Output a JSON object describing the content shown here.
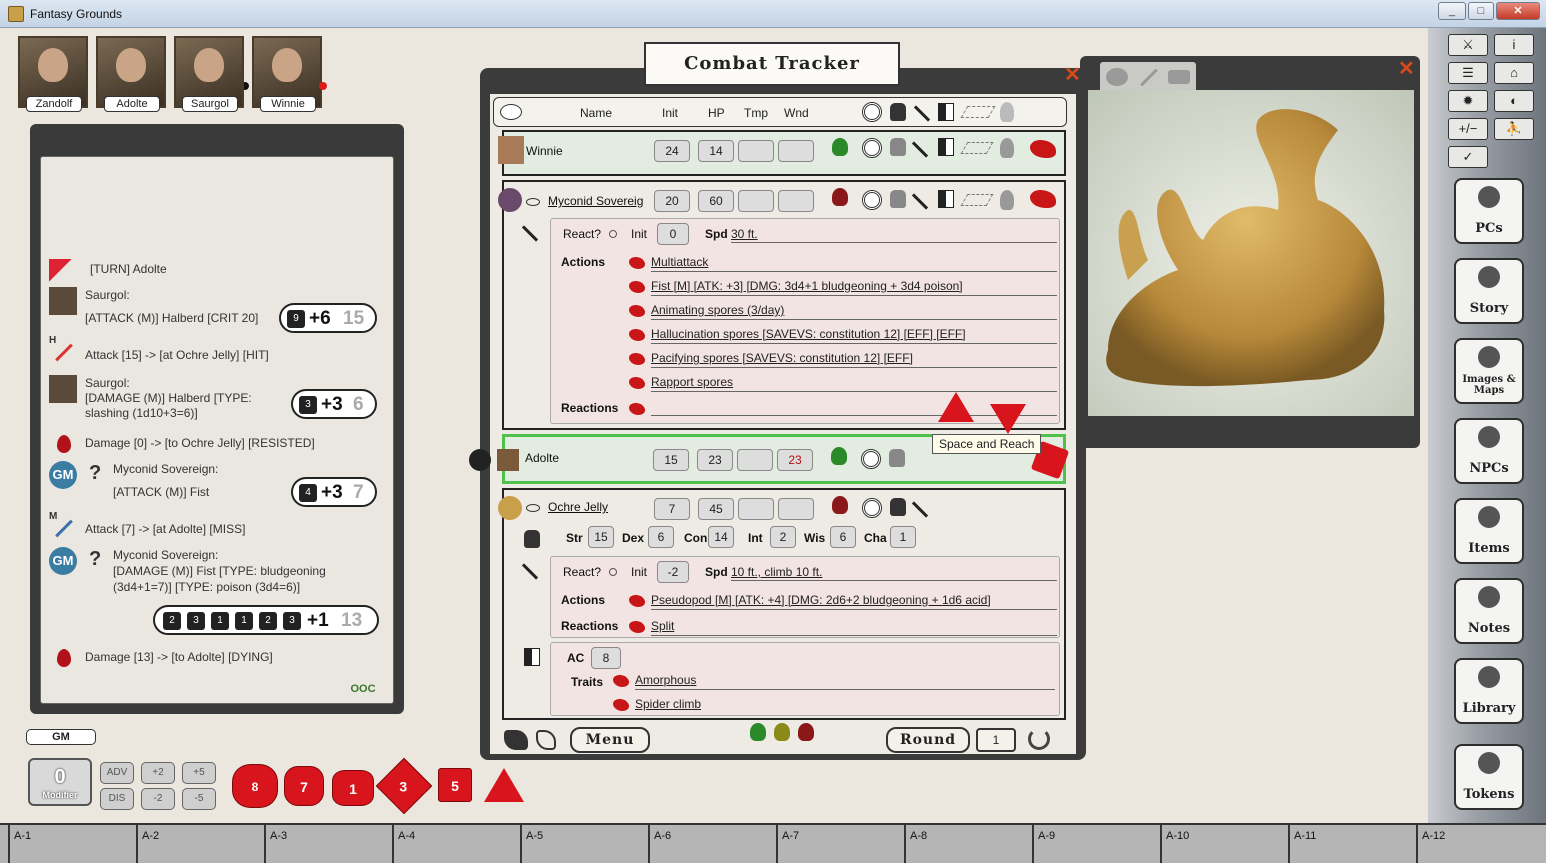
{
  "window": {
    "title": "Fantasy Grounds",
    "minimize": "_",
    "maximize": "□",
    "close": "✕"
  },
  "party": [
    {
      "name": "Zandolf"
    },
    {
      "name": "Adolte"
    },
    {
      "name": "Saurgol"
    },
    {
      "name": "Winnie"
    }
  ],
  "chat": {
    "entries": [
      {
        "text": "[TURN] Adolte"
      },
      {
        "speaker": "Saurgol:",
        "text": "[ATTACK (M)] Halberd [CRIT 20]",
        "roll": {
          "die": "9",
          "mod": "+6",
          "total": "15"
        }
      },
      {
        "text": "Attack [15] -> [at Ochre Jelly] [HIT]",
        "tag": "H"
      },
      {
        "speaker": "Saurgol:",
        "text": "[DAMAGE (M)] Halberd [TYPE:",
        "text2": "slashing (1d10+3=6)]",
        "roll": {
          "die": "3",
          "mod": "+3",
          "total": "6"
        }
      },
      {
        "text": "Damage [0] -> [to Ochre Jelly] [RESISTED]"
      },
      {
        "speaker": "Myconid Sovereign:",
        "text": "[ATTACK (M)] Fist",
        "roll": {
          "die": "4",
          "mod": "+3",
          "total": "7"
        }
      },
      {
        "text": "Attack [7] -> [at Adolte] [MISS]",
        "tag": "M"
      },
      {
        "speaker": "Myconid Sovereign:",
        "text": "[DAMAGE (M)] Fist [TYPE: bludgeoning",
        "text2": "(3d4+1=7)] [TYPE: poison (3d4=6)]",
        "roll": {
          "dice": [
            "2",
            "3",
            "1",
            "1",
            "2",
            "3"
          ],
          "mod": "+1",
          "total": "13"
        }
      },
      {
        "text": "Damage [13] -> [to Adolte] [DYING]"
      }
    ],
    "gm_badge": "GM",
    "ooc": "OOC",
    "question": "?"
  },
  "controls": {
    "gm_label": "GM",
    "modifier_value": "0",
    "modifier_label": "Modifier",
    "buttons": [
      "ADV",
      "+2",
      "+5",
      "DIS",
      "-2",
      "-5"
    ],
    "dice": [
      "8",
      "7",
      "1",
      "3",
      "5"
    ]
  },
  "combat_tracker": {
    "title": "Combat Tracker",
    "headers": {
      "name": "Name",
      "init": "Init",
      "hp": "HP",
      "tmp": "Tmp",
      "wnd": "Wnd"
    },
    "combatants": [
      {
        "name": "Winnie",
        "init": "24",
        "hp": "14",
        "tmp": "",
        "wnd": ""
      },
      {
        "name": "Myconid Sovereig",
        "init": "20",
        "hp": "60",
        "tmp": "",
        "wnd": "",
        "react_label": "React?",
        "init_label": "Init",
        "init_val": "0",
        "spd_label": "Spd",
        "spd_val": "30 ft.",
        "actions_label": "Actions",
        "reactions_label": "Reactions",
        "actions": [
          "Multiattack",
          "Fist [M] [ATK: +3] [DMG: 3d4+1 bludgeoning + 3d4 poison]",
          "Animating spores (3/day)",
          "Hallucination spores [SAVEVS: constitution 12] [EFF] [EFF]",
          "Pacifying spores [SAVEVS: constitution 12] [EFF]",
          "Rapport spores"
        ]
      },
      {
        "name": "Adolte",
        "init": "15",
        "hp": "23",
        "tmp": "",
        "wnd": "23"
      },
      {
        "name": "Ochre Jelly",
        "init": "7",
        "hp": "45",
        "tmp": "",
        "wnd": "",
        "stats": [
          {
            "k": "Str",
            "v": "15"
          },
          {
            "k": "Dex",
            "v": "6"
          },
          {
            "k": "Con",
            "v": "14"
          },
          {
            "k": "Int",
            "v": "2"
          },
          {
            "k": "Wis",
            "v": "6"
          },
          {
            "k": "Cha",
            "v": "1"
          }
        ],
        "react_label": "React?",
        "init_label": "Init",
        "init_val": "-2",
        "spd_label": "Spd",
        "spd_val": "10 ft., climb 10 ft.",
        "actions_label": "Actions",
        "reactions_label": "Reactions",
        "actions": [
          "Pseudopod [M] [ATK: +4] [DMG: 2d6+2 bludgeoning + 1d6 acid]"
        ],
        "reactions": [
          "Split"
        ],
        "ac_label": "AC",
        "ac_val": "8",
        "traits_label": "Traits",
        "traits": [
          "Amorphous",
          "Spider climb"
        ]
      }
    ],
    "tooltip": "Space and Reach",
    "menu": "Menu",
    "round_label": "Round",
    "round_value": "1"
  },
  "sidebar": {
    "tools": [
      "⚔",
      "i",
      "☰",
      "⌂",
      "✹",
      "◐",
      "+/−",
      "⛹",
      "✓"
    ],
    "buttons": [
      "PCs",
      "Story",
      "Images & Maps",
      "NPCs",
      "Items",
      "Notes",
      "Library",
      "Tokens"
    ]
  },
  "grid": [
    "A-1",
    "A-2",
    "A-3",
    "A-4",
    "A-5",
    "A-6",
    "A-7",
    "A-8",
    "A-9",
    "A-10",
    "A-11",
    "A-12"
  ],
  "colors": {
    "accent_red": "#d8141c",
    "active_green": "#4ec24a",
    "paper": "#eeebe4"
  }
}
